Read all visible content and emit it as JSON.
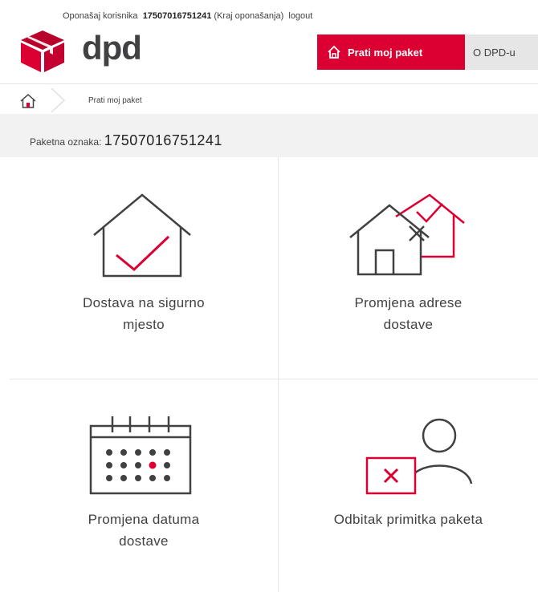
{
  "topbar": {
    "impersonate_label": "Oponašaj korisnika",
    "user_id": "17507016751241",
    "end_impersonation": "(Kraj oponašanja)",
    "logout": "logout"
  },
  "logo": {
    "wordmark": "dpd",
    "brand_color": "#dc0032"
  },
  "nav": {
    "track_label": "Prati moj paket",
    "about_label": "O DPD-u",
    "icons": [
      "home-icon"
    ]
  },
  "breadcrumb": {
    "current": "Prati moj paket"
  },
  "parcel": {
    "label": "Paketna oznaka:",
    "number": "17507016751241"
  },
  "options": [
    {
      "label_line1": "Dostava na sigurno",
      "label_line2": "mjesto",
      "icon": "house-check-icon"
    },
    {
      "label_line1": "Promjena adrese",
      "label_line2": "dostave",
      "icon": "house-change-icon"
    },
    {
      "label_line1": "Promjena datuma",
      "label_line2": "dostave",
      "icon": "calendar-icon"
    },
    {
      "label_line1": "Odbitak primitka paketa",
      "label_line2": "",
      "icon": "refuse-parcel-icon"
    }
  ],
  "colors": {
    "accent": "#dc0032",
    "text": "#414042",
    "band": "#f2f2f2"
  }
}
